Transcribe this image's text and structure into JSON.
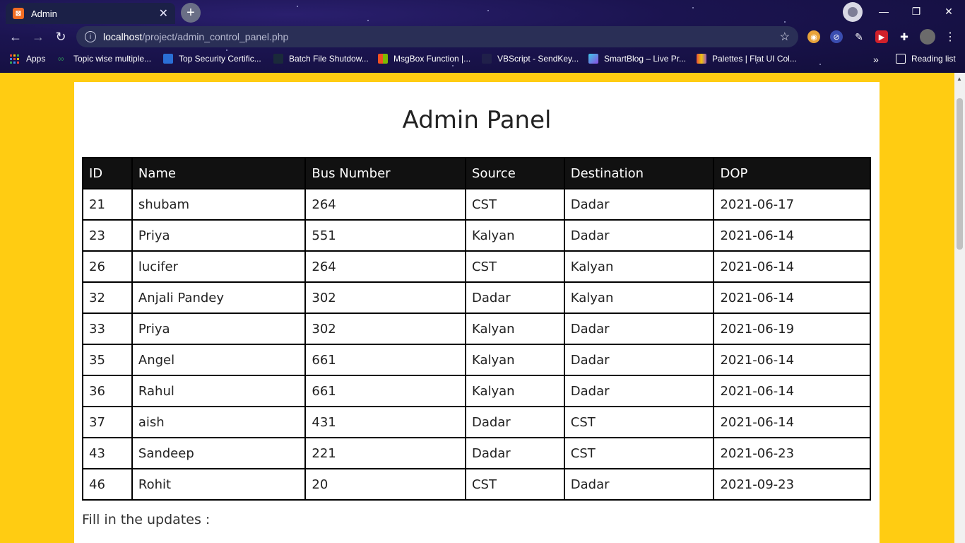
{
  "browser": {
    "tab_title": "Admin",
    "tab_close": "✕",
    "new_tab": "+",
    "url_host": "localhost",
    "url_path": "/project/admin_control_panel.php",
    "bookmarks": [
      "Apps",
      "Topic wise multiple...",
      "Top Security Certific...",
      "Batch File Shutdow...",
      "MsgBox Function |...",
      "VBScript - SendKey...",
      "SmartBlog – Live Pr...",
      "Palettes | Flat UI Col..."
    ],
    "more_bookmarks": "»",
    "reading_list": "Reading list"
  },
  "page": {
    "title": "Admin Panel",
    "fill_label": "Fill in the updates :"
  },
  "table": {
    "headers": [
      "ID",
      "Name",
      "Bus Number",
      "Source",
      "Destination",
      "DOP"
    ],
    "rows": [
      [
        "21",
        "shubam",
        "264",
        "CST",
        "Dadar",
        "2021-06-17"
      ],
      [
        "23",
        "Priya",
        "551",
        "Kalyan",
        "Dadar",
        "2021-06-14"
      ],
      [
        "26",
        "lucifer",
        "264",
        "CST",
        "Kalyan",
        "2021-06-14"
      ],
      [
        "32",
        "Anjali Pandey",
        "302",
        "Dadar",
        "Kalyan",
        "2021-06-14"
      ],
      [
        "33",
        "Priya",
        "302",
        "Kalyan",
        "Dadar",
        "2021-06-19"
      ],
      [
        "35",
        "Angel",
        "661",
        "Kalyan",
        "Dadar",
        "2021-06-14"
      ],
      [
        "36",
        "Rahul",
        "661",
        "Kalyan",
        "Dadar",
        "2021-06-14"
      ],
      [
        "37",
        "aish",
        "431",
        "Dadar",
        "CST",
        "2021-06-14"
      ],
      [
        "43",
        "Sandeep",
        "221",
        "Dadar",
        "CST",
        "2021-06-23"
      ],
      [
        "46",
        "Rohit",
        "20",
        "CST",
        "Dadar",
        "2021-09-23"
      ]
    ]
  }
}
